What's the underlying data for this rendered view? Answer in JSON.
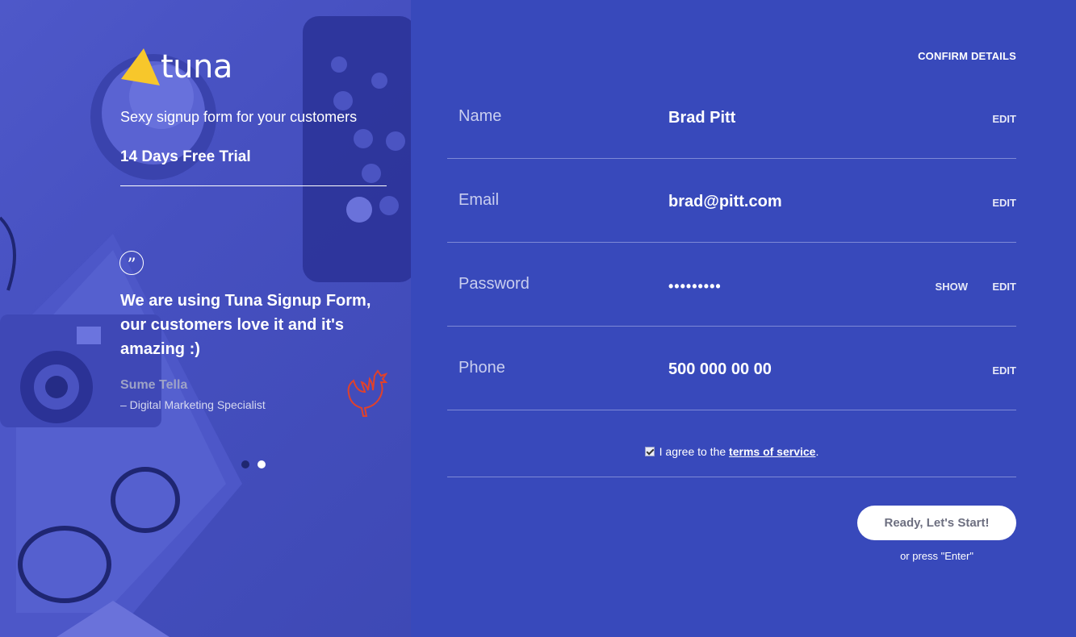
{
  "brand": {
    "name": "tuna",
    "tagline": "Sexy signup form for your customers",
    "trial": "14 Days Free Trial",
    "accent": "#f7c72b"
  },
  "testimonial": {
    "text": "We are using Tuna Signup Form, our customers love it and it's amazing :)",
    "author": "Sume Tella",
    "role": "– Digital Marketing Specialist",
    "slides": 2,
    "active_slide": 2
  },
  "form": {
    "title": "CONFIRM DETAILS",
    "fields": [
      {
        "label": "Name",
        "value": "Brad Pitt",
        "edit": "EDIT"
      },
      {
        "label": "Email",
        "value": "brad@pitt.com",
        "edit": "EDIT"
      },
      {
        "label": "Password",
        "value": "•••••••••",
        "show": "SHOW",
        "edit": "EDIT"
      },
      {
        "label": "Phone",
        "value": "500 000 00 00",
        "edit": "EDIT"
      }
    ],
    "agree_prefix": "I agree to the ",
    "agree_link": "terms of service",
    "agree_suffix": ".",
    "agree_checked": true,
    "submit_label": "Ready, Let's Start!",
    "enter_hint": "or press \"Enter\""
  },
  "colors": {
    "panel_bg": "#3849bb",
    "divider": "#7e89d6",
    "rooster": "#e0412b"
  }
}
